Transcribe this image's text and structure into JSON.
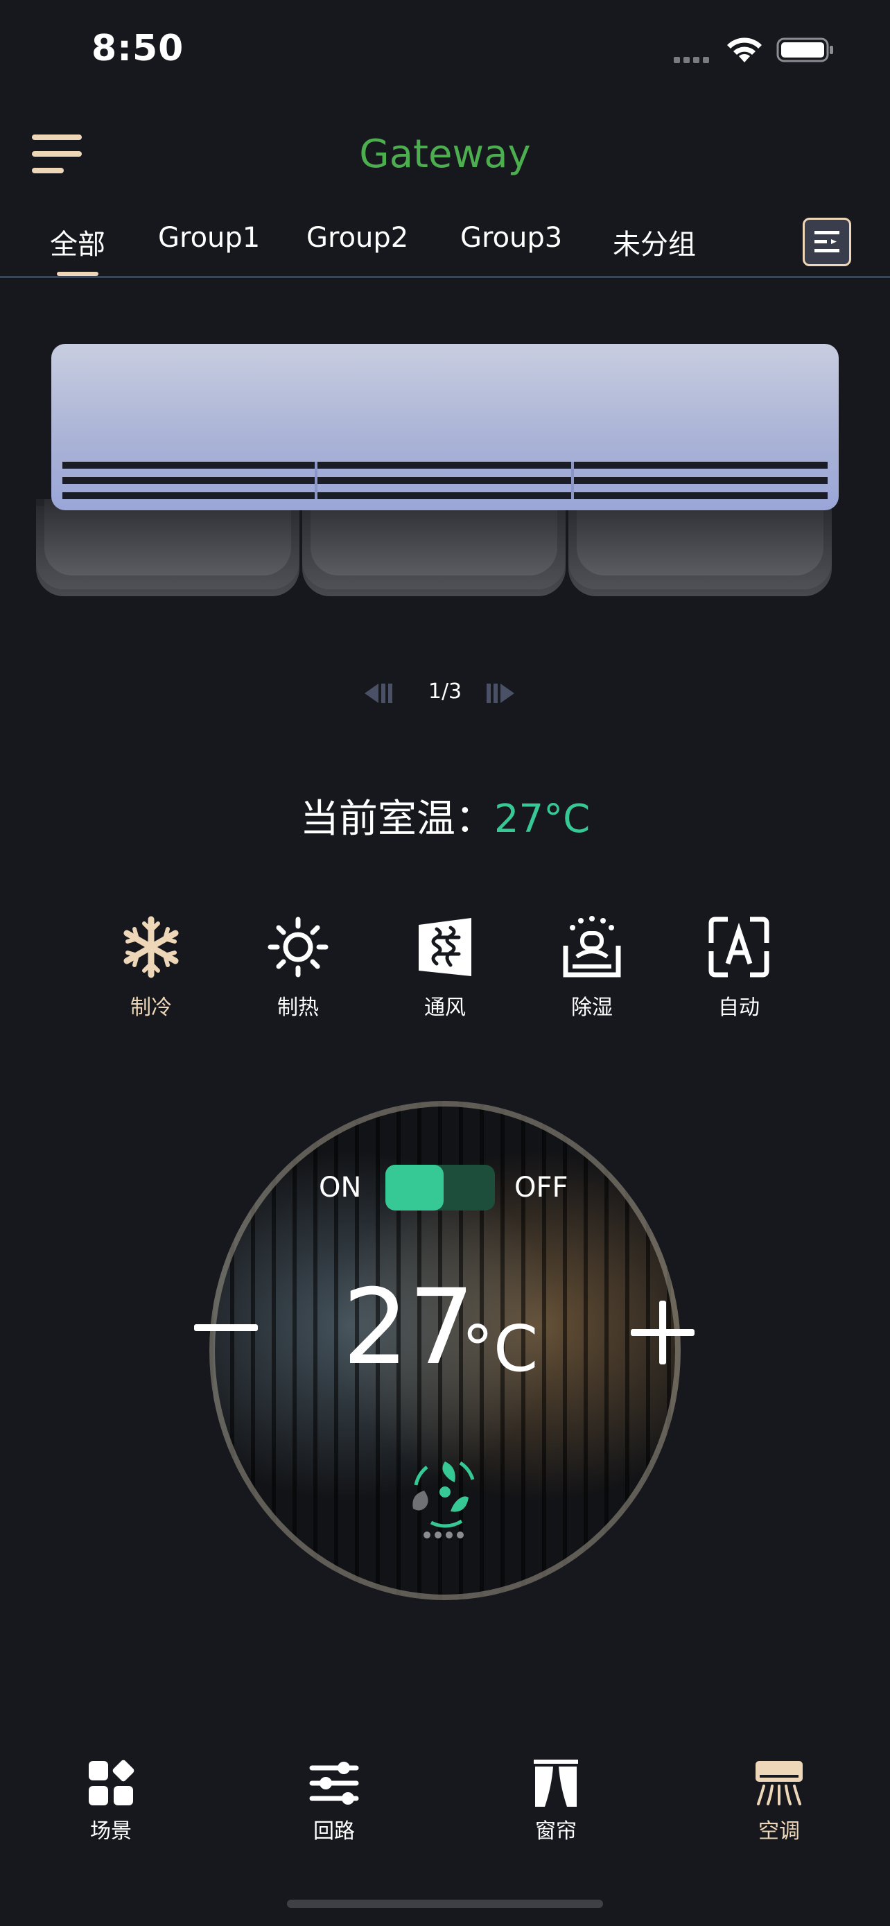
{
  "status_bar": {
    "time": "8:50"
  },
  "header": {
    "title": "Gateway"
  },
  "tabs": [
    {
      "label": "全部",
      "active": true
    },
    {
      "label": "Group1",
      "active": false
    },
    {
      "label": "Group2",
      "active": false
    },
    {
      "label": "Group3",
      "active": false
    },
    {
      "label": "未分组",
      "active": false
    }
  ],
  "pager": {
    "text": "1/3"
  },
  "room_temp": {
    "label": "当前室温：",
    "value": "27°C"
  },
  "modes": [
    {
      "label": "制冷",
      "icon": "snowflake-icon",
      "active": true
    },
    {
      "label": "制热",
      "icon": "sun-icon",
      "active": false
    },
    {
      "label": "通风",
      "icon": "ventilation-icon",
      "active": false
    },
    {
      "label": "除湿",
      "icon": "dehumidify-icon",
      "active": false
    },
    {
      "label": "自动",
      "icon": "auto-icon",
      "active": false
    }
  ],
  "control": {
    "on_label": "ON",
    "off_label": "OFF",
    "power_on": true,
    "set_temp": "27",
    "unit": "°C"
  },
  "bottom_nav": [
    {
      "label": "场景",
      "icon": "scene-icon",
      "active": false
    },
    {
      "label": "回路",
      "icon": "circuit-icon",
      "active": false
    },
    {
      "label": "窗帘",
      "icon": "curtain-icon",
      "active": false
    },
    {
      "label": "空调",
      "icon": "air-conditioner-icon",
      "active": true
    }
  ],
  "colors": {
    "accent": "#eed7b8",
    "green": "#37c995",
    "title_green": "#4cae4f",
    "background": "#17181d"
  }
}
